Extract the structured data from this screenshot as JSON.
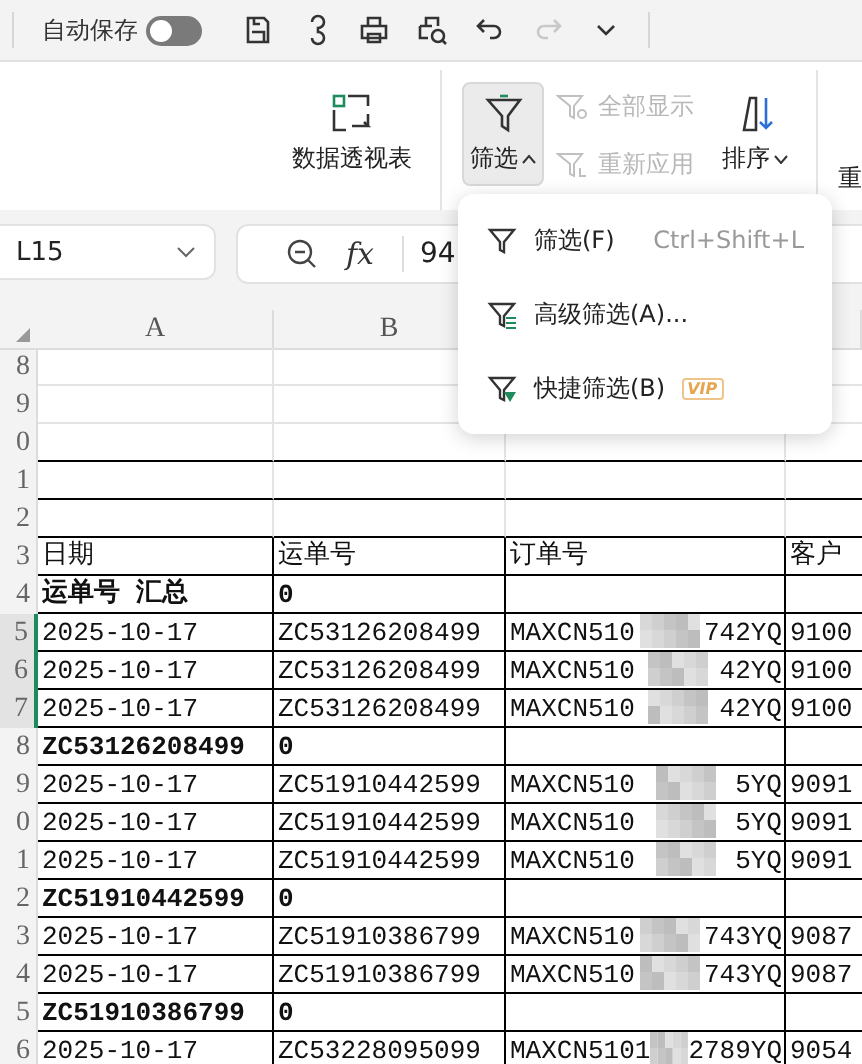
{
  "title_bar": {
    "autosave_label": "自动保存",
    "autosave_on": false
  },
  "ribbon": {
    "pivot": "数据透视表",
    "filter": {
      "label": "筛选",
      "pressed": true
    },
    "show_all": {
      "label": "全部显示",
      "disabled": true
    },
    "reapply": {
      "label": "重新应用",
      "disabled": true
    },
    "sort": "排序",
    "next_cut": "重"
  },
  "name_box": "L15",
  "fx_label": "fx",
  "formula": "94",
  "filter_menu": [
    {
      "kind": "filter",
      "label": "筛选(F)",
      "shortcut": "Ctrl+Shift+L"
    },
    {
      "kind": "advanced",
      "label": "高级筛选(A)..."
    },
    {
      "kind": "quick",
      "label": "快捷筛选(B)",
      "badge": "VIP"
    }
  ],
  "columns": [
    "A",
    "B"
  ],
  "rows": [
    {
      "num": "8",
      "kind": "blank",
      "selected": false
    },
    {
      "num": "9",
      "kind": "blank",
      "selected": false
    },
    {
      "num": "0",
      "kind": "ruled",
      "selected": false
    },
    {
      "num": "1",
      "kind": "ruled",
      "selected": false
    },
    {
      "num": "2",
      "kind": "ruled",
      "selected": false
    },
    {
      "num": "3",
      "kind": "header",
      "selected": false,
      "cells": [
        "日期",
        "运单号",
        "订单号",
        "客户"
      ]
    },
    {
      "num": "4",
      "kind": "total",
      "selected": false,
      "cells": [
        "运单号 汇总",
        "0"
      ]
    },
    {
      "num": "5",
      "kind": "data",
      "selected": true,
      "cells": [
        "2025-10-17",
        "ZC53126208499",
        "MAXCN510",
        "742YQ",
        "9100"
      ]
    },
    {
      "num": "6",
      "kind": "data",
      "selected": true,
      "cells": [
        "2025-10-17",
        "ZC53126208499",
        "MAXCN510",
        "42YQ",
        "9100"
      ]
    },
    {
      "num": "7",
      "kind": "data",
      "selected": true,
      "cells": [
        "2025-10-17",
        "ZC53126208499",
        "MAXCN510",
        "42YQ",
        "9100"
      ]
    },
    {
      "num": "8",
      "kind": "total",
      "selected": false,
      "cells": [
        "ZC53126208499",
        "0"
      ]
    },
    {
      "num": "9",
      "kind": "data",
      "selected": false,
      "cells": [
        "2025-10-17",
        "ZC51910442599",
        "MAXCN510",
        "5YQ",
        "9091"
      ]
    },
    {
      "num": "0",
      "kind": "data",
      "selected": false,
      "cells": [
        "2025-10-17",
        "ZC51910442599",
        "MAXCN510",
        "5YQ",
        "9091"
      ]
    },
    {
      "num": "1",
      "kind": "data",
      "selected": false,
      "cells": [
        "2025-10-17",
        "ZC51910442599",
        "MAXCN510",
        "5YQ",
        "9091"
      ]
    },
    {
      "num": "2",
      "kind": "total",
      "selected": false,
      "cells": [
        "ZC51910442599",
        "0"
      ]
    },
    {
      "num": "3",
      "kind": "data",
      "selected": false,
      "cells": [
        "2025-10-17",
        "ZC51910386799",
        "MAXCN510",
        "743YQ",
        "9087"
      ]
    },
    {
      "num": "4",
      "kind": "data",
      "selected": false,
      "cells": [
        "2025-10-17",
        "ZC51910386799",
        "MAXCN510",
        "743YQ",
        "9087"
      ]
    },
    {
      "num": "5",
      "kind": "total",
      "selected": false,
      "cells": [
        "ZC51910386799",
        "0"
      ]
    },
    {
      "num": "6",
      "kind": "data",
      "selected": false,
      "cells": [
        "2025-10-17",
        "ZC53228095099",
        "MAXCN5101",
        "2789YQ",
        "9054"
      ]
    }
  ]
}
